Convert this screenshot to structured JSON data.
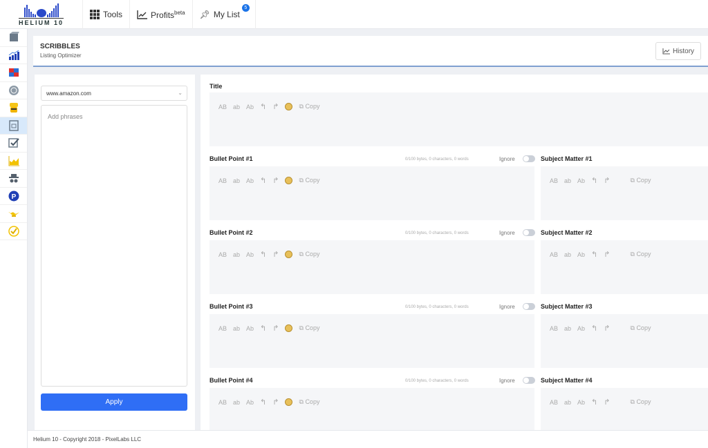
{
  "topbar": {
    "logo_text": "HELIUM 10",
    "tabs": [
      {
        "label": "Tools",
        "icon": "grid-icon"
      },
      {
        "label": "Profits",
        "sup": "beta",
        "icon": "chart-line-icon"
      },
      {
        "label": "My List",
        "icon": "pin-icon",
        "badge": "5"
      }
    ]
  },
  "sidebar": {
    "items": [
      {
        "icon": "cube-icon"
      },
      {
        "icon": "bar-chart-icon"
      },
      {
        "icon": "puzzle-icon"
      },
      {
        "icon": "brain-icon"
      },
      {
        "icon": "chef-icon"
      },
      {
        "icon": "document-icon",
        "active": true
      },
      {
        "icon": "checkbox-icon"
      },
      {
        "icon": "area-chart-icon"
      },
      {
        "icon": "spy-icon"
      },
      {
        "icon": "p-circle-icon"
      },
      {
        "icon": "genie-lamp-icon"
      },
      {
        "icon": "check-circle-icon"
      }
    ]
  },
  "header": {
    "title": "SCRIBBLES",
    "subtitle": "Listing Optimizer",
    "history_label": "History"
  },
  "left_panel": {
    "marketplace": "www.amazon.com",
    "phrases_placeholder": "Add phrases",
    "apply_label": "Apply"
  },
  "toolbar": {
    "upper": "AB",
    "lower": "ab",
    "title_case": "Ab",
    "copy": "Copy"
  },
  "editor": {
    "title_label": "Title",
    "ignore_label": "Ignore",
    "bullets": [
      {
        "label": "Bullet Point #1",
        "meta": "0/100 bytes, 0 characters, 0 words",
        "subject": "Subject Matter #1"
      },
      {
        "label": "Bullet Point #2",
        "meta": "0/100 bytes, 0 characters, 0 words",
        "subject": "Subject Matter #2"
      },
      {
        "label": "Bullet Point #3",
        "meta": "0/100 bytes, 0 characters, 0 words",
        "subject": "Subject Matter #3"
      },
      {
        "label": "Bullet Point #4",
        "meta": "0/100 bytes, 0 characters, 0 words",
        "subject": "Subject Matter #4"
      }
    ]
  },
  "footer": {
    "text": "Helium 10 - Copyright 2018 - PixelLabs LLC"
  }
}
